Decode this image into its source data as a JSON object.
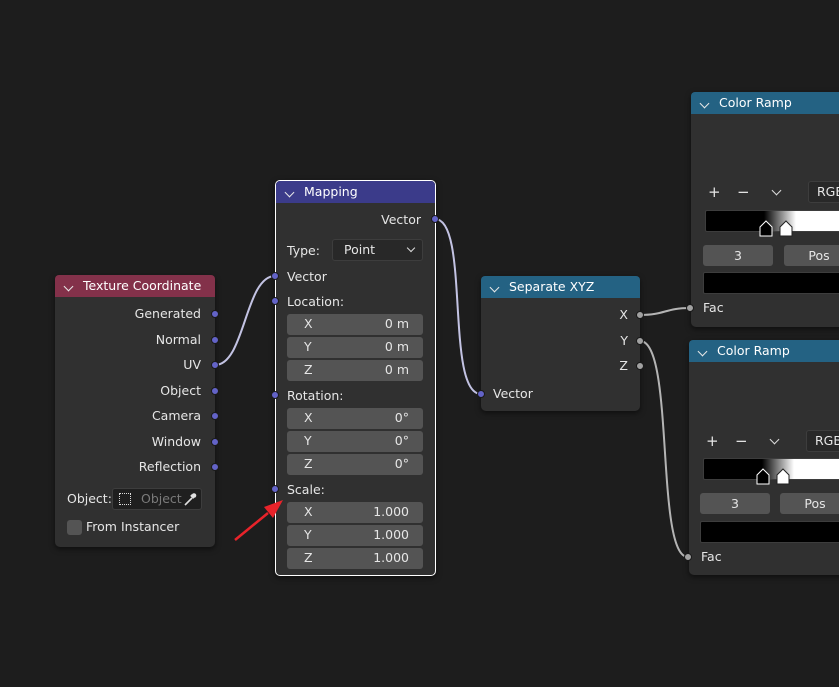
{
  "texture_coordinate": {
    "title": "Texture Coordinate",
    "outputs": [
      "Generated",
      "Normal",
      "UV",
      "Object",
      "Camera",
      "Window",
      "Reflection"
    ],
    "object_label": "Object:",
    "object_placeholder": "Object",
    "from_instancer": "From Instancer"
  },
  "mapping": {
    "title": "Mapping",
    "output_vector": "Vector",
    "type_label": "Type:",
    "type_value": "Point",
    "input_vector": "Vector",
    "location_label": "Location:",
    "location": [
      {
        "axis": "X",
        "value": "0 m"
      },
      {
        "axis": "Y",
        "value": "0 m"
      },
      {
        "axis": "Z",
        "value": "0 m"
      }
    ],
    "rotation_label": "Rotation:",
    "rotation": [
      {
        "axis": "X",
        "value": "0°"
      },
      {
        "axis": "Y",
        "value": "0°"
      },
      {
        "axis": "Z",
        "value": "0°"
      }
    ],
    "scale_label": "Scale:",
    "scale": [
      {
        "axis": "X",
        "value": "1.000"
      },
      {
        "axis": "Y",
        "value": "1.000"
      },
      {
        "axis": "Z",
        "value": "1.000"
      }
    ]
  },
  "separate_xyz": {
    "title": "Separate XYZ",
    "outputs": [
      "X",
      "Y",
      "Z"
    ],
    "input": "Vector"
  },
  "color_ramp_1": {
    "title": "Color Ramp",
    "add": "+",
    "remove": "−",
    "mode": "RGB",
    "index": "3",
    "pos": "Pos",
    "input": "Fac"
  },
  "color_ramp_2": {
    "title": "Color Ramp",
    "add": "+",
    "remove": "−",
    "mode": "RGB",
    "index": "3",
    "pos": "Pos",
    "input": "Fac"
  },
  "colors": {
    "background": "#1d1d1d",
    "node_body": "#303030",
    "texture_header": "#83314a",
    "vector_header": "#3b3b8a",
    "converter_header": "#246283",
    "vector_socket": "#6363c7",
    "float_socket": "#a1a1a1",
    "field": "#545454",
    "annotation_arrow": "#e8232a"
  }
}
